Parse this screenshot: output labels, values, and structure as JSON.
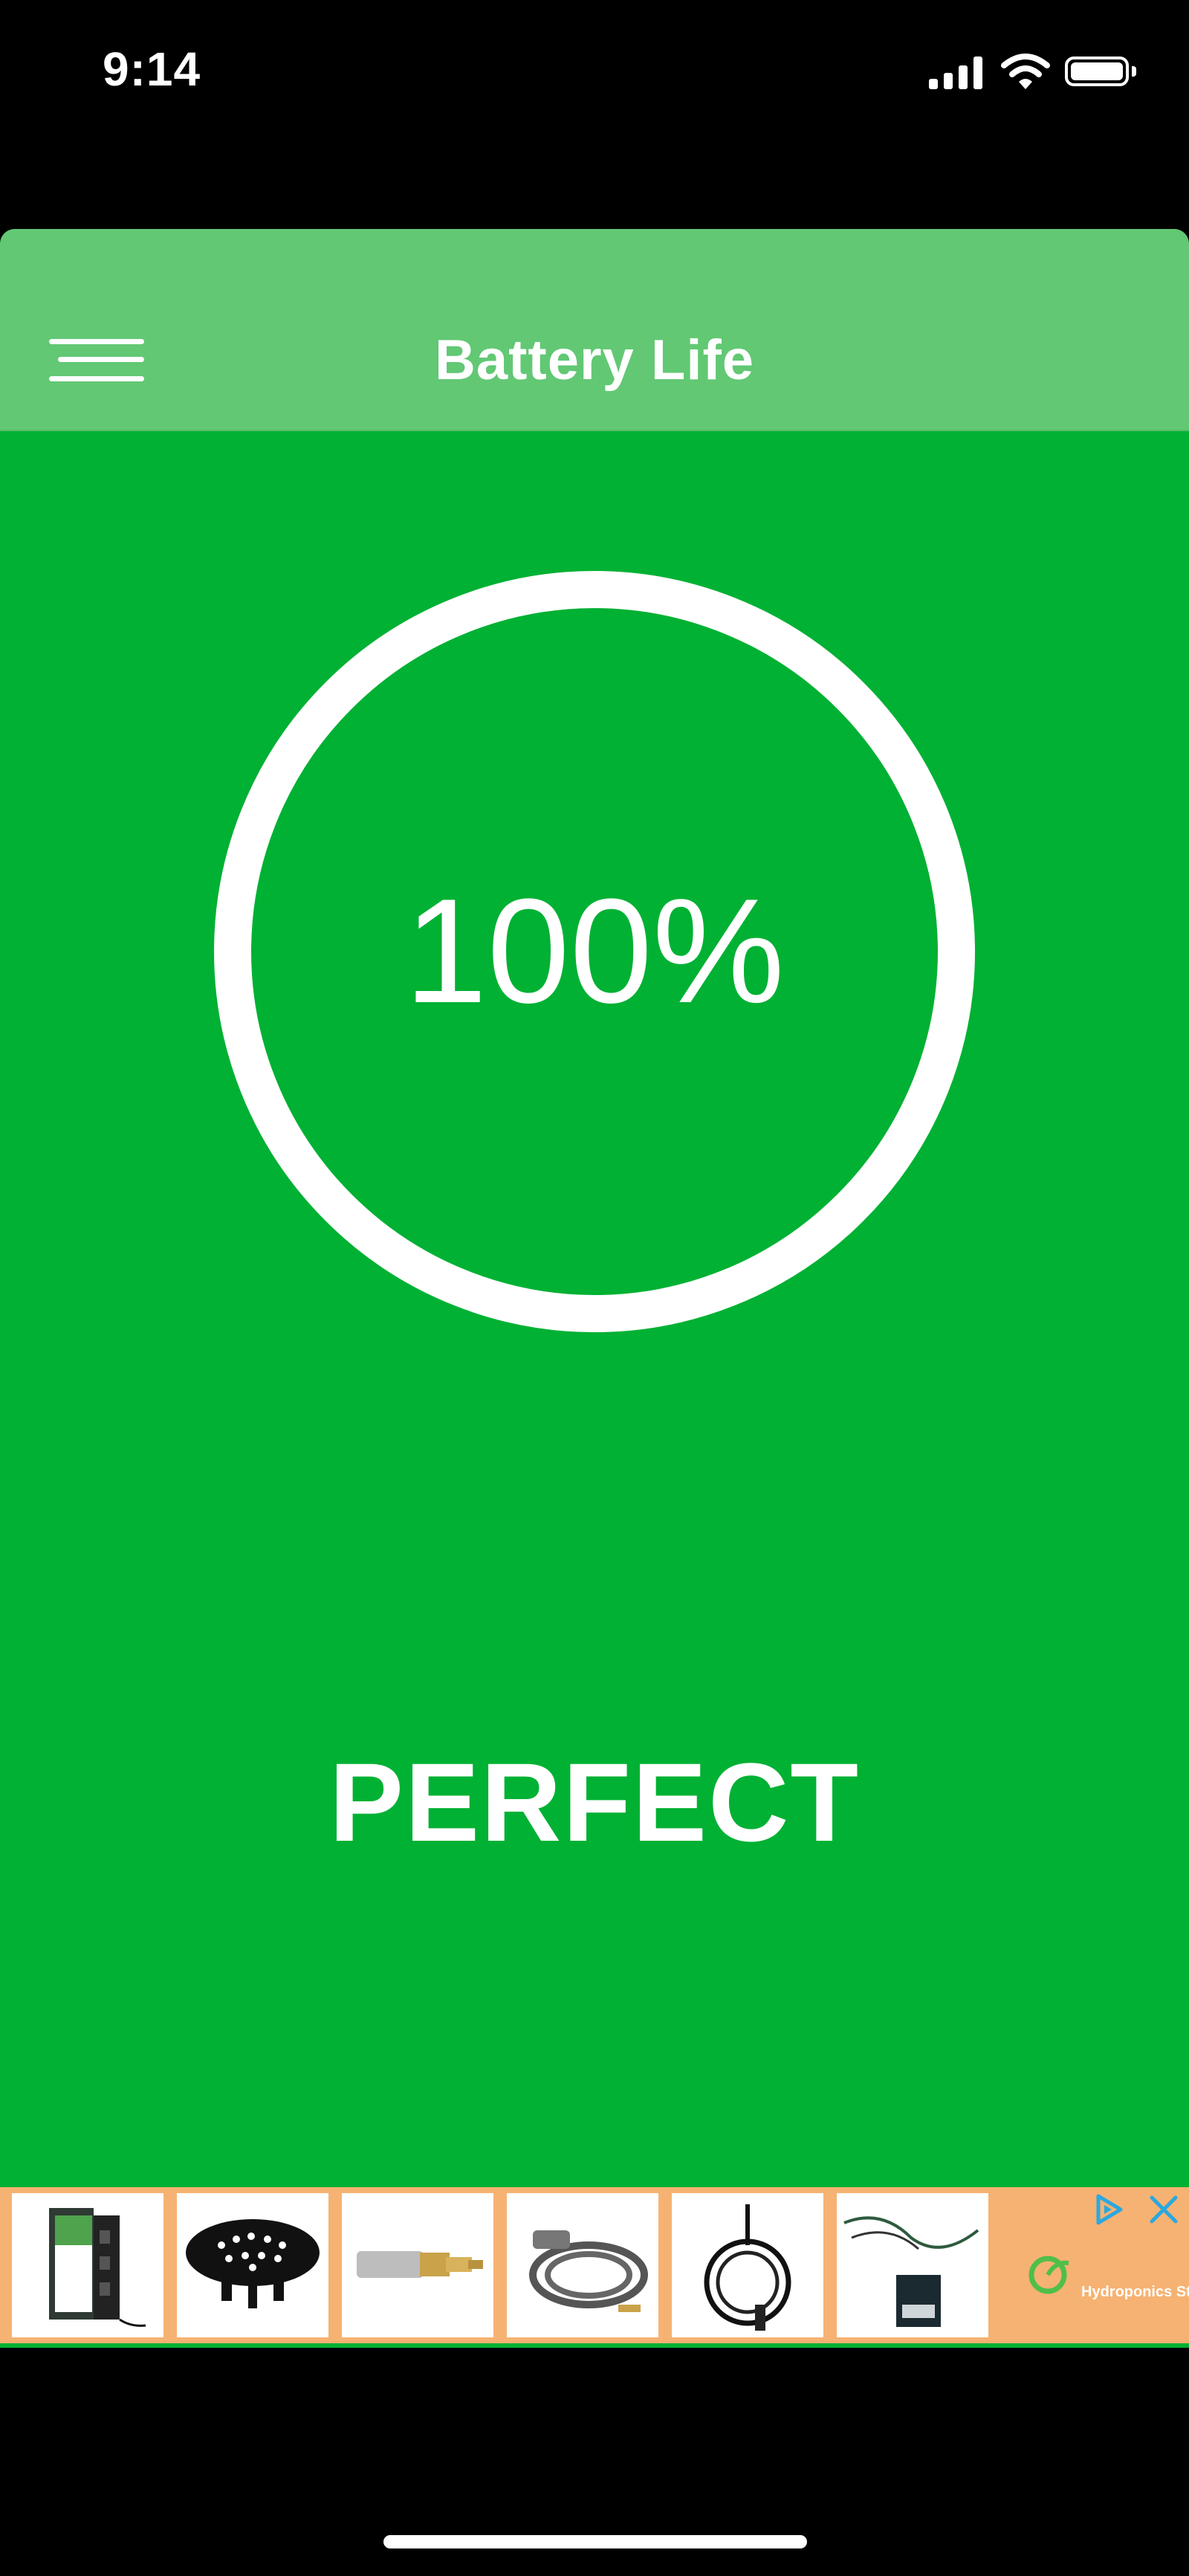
{
  "status_bar": {
    "time": "9:14"
  },
  "header": {
    "title": "Battery Life",
    "menu_icon": "hamburger-menu-icon"
  },
  "battery": {
    "percent_label": "100%",
    "percent_value": 100,
    "status": "PERFECT"
  },
  "ad": {
    "brand_text": "Hydroponics Store",
    "items": [
      "power-controller-product",
      "black-plastic-tray-product",
      "brass-fitting-product",
      "gray-hose-product",
      "black-cable-product",
      "wiring-harness-product"
    ]
  },
  "colors": {
    "app_background": "#00b133",
    "header_background": "#62c874",
    "ad_background": "#f6b272",
    "ad_choice_blue": "#2aa8e0"
  }
}
